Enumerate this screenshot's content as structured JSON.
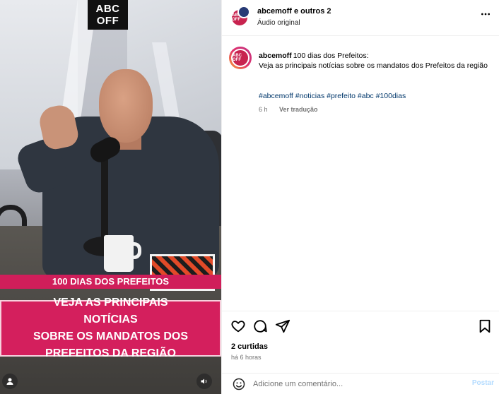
{
  "video": {
    "logo_line1": "ABC",
    "logo_line2": "OFF",
    "banner_small": "100 DIAS DOS PREFEITOS",
    "banner_big": "VEJA AS PRINCIPAIS NOTÍCIAS\nSOBRE OS MANDATOS DOS\nPREFEITOS DA REGIÃO",
    "user_tag_icon": "user-icon",
    "mute_icon": "speaker-icon"
  },
  "header": {
    "avatar_text": "ABC OFF",
    "user": "abcemoff e outros 2",
    "audio": "Áudio original",
    "more_icon": "more-horizontal-icon"
  },
  "caption": {
    "avatar_text": "ABC OFF",
    "user": "abcemoff",
    "text": "100 dias dos Prefeitos:\nVeja as principais notícias sobre os mandatos dos Prefeitos da região",
    "hashtags": "#abcemoff #noticias #prefeito #abc #100dias",
    "time": "6 h",
    "translate": "Ver tradução"
  },
  "actions": {
    "like_icon": "heart-icon",
    "comment_icon": "comment-icon",
    "share_icon": "send-icon",
    "save_icon": "bookmark-icon",
    "likes": "2 curtidas",
    "time_ago": "há 6 horas"
  },
  "comment": {
    "emoji_icon": "smiley-icon",
    "placeholder": "Adicione um comentário...",
    "post_label": "Postar"
  },
  "colors": {
    "banner": "#d41f5d",
    "link": "#00376b",
    "post_disabled": "#b3dbff"
  }
}
